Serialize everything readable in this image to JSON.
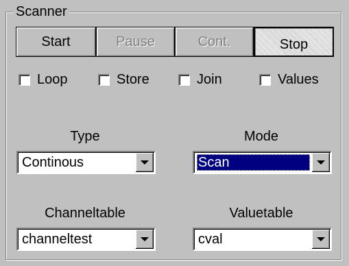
{
  "group": {
    "title": "Scanner"
  },
  "buttons": {
    "start": "Start",
    "pause": "Pause",
    "cont": "Cont.",
    "stop": "Stop"
  },
  "checkboxes": {
    "loop": {
      "label": "Loop",
      "checked": false
    },
    "store": {
      "label": "Store",
      "checked": false
    },
    "join": {
      "label": "Join",
      "checked": false
    },
    "values": {
      "label": "Values",
      "checked": false
    }
  },
  "type": {
    "label": "Type",
    "value": "Continous"
  },
  "mode": {
    "label": "Mode",
    "value": "Scan"
  },
  "channeltable": {
    "label": "Channeltable",
    "value": "channeltest"
  },
  "valuetable": {
    "label": "Valuetable",
    "value": "cval"
  },
  "icons": {
    "dropdown": "chevron-down-icon",
    "checkbox": "checkbox-empty"
  },
  "colors": {
    "face": "#c0c0c0",
    "selection": "#000080",
    "disabled_text": "#808080"
  }
}
